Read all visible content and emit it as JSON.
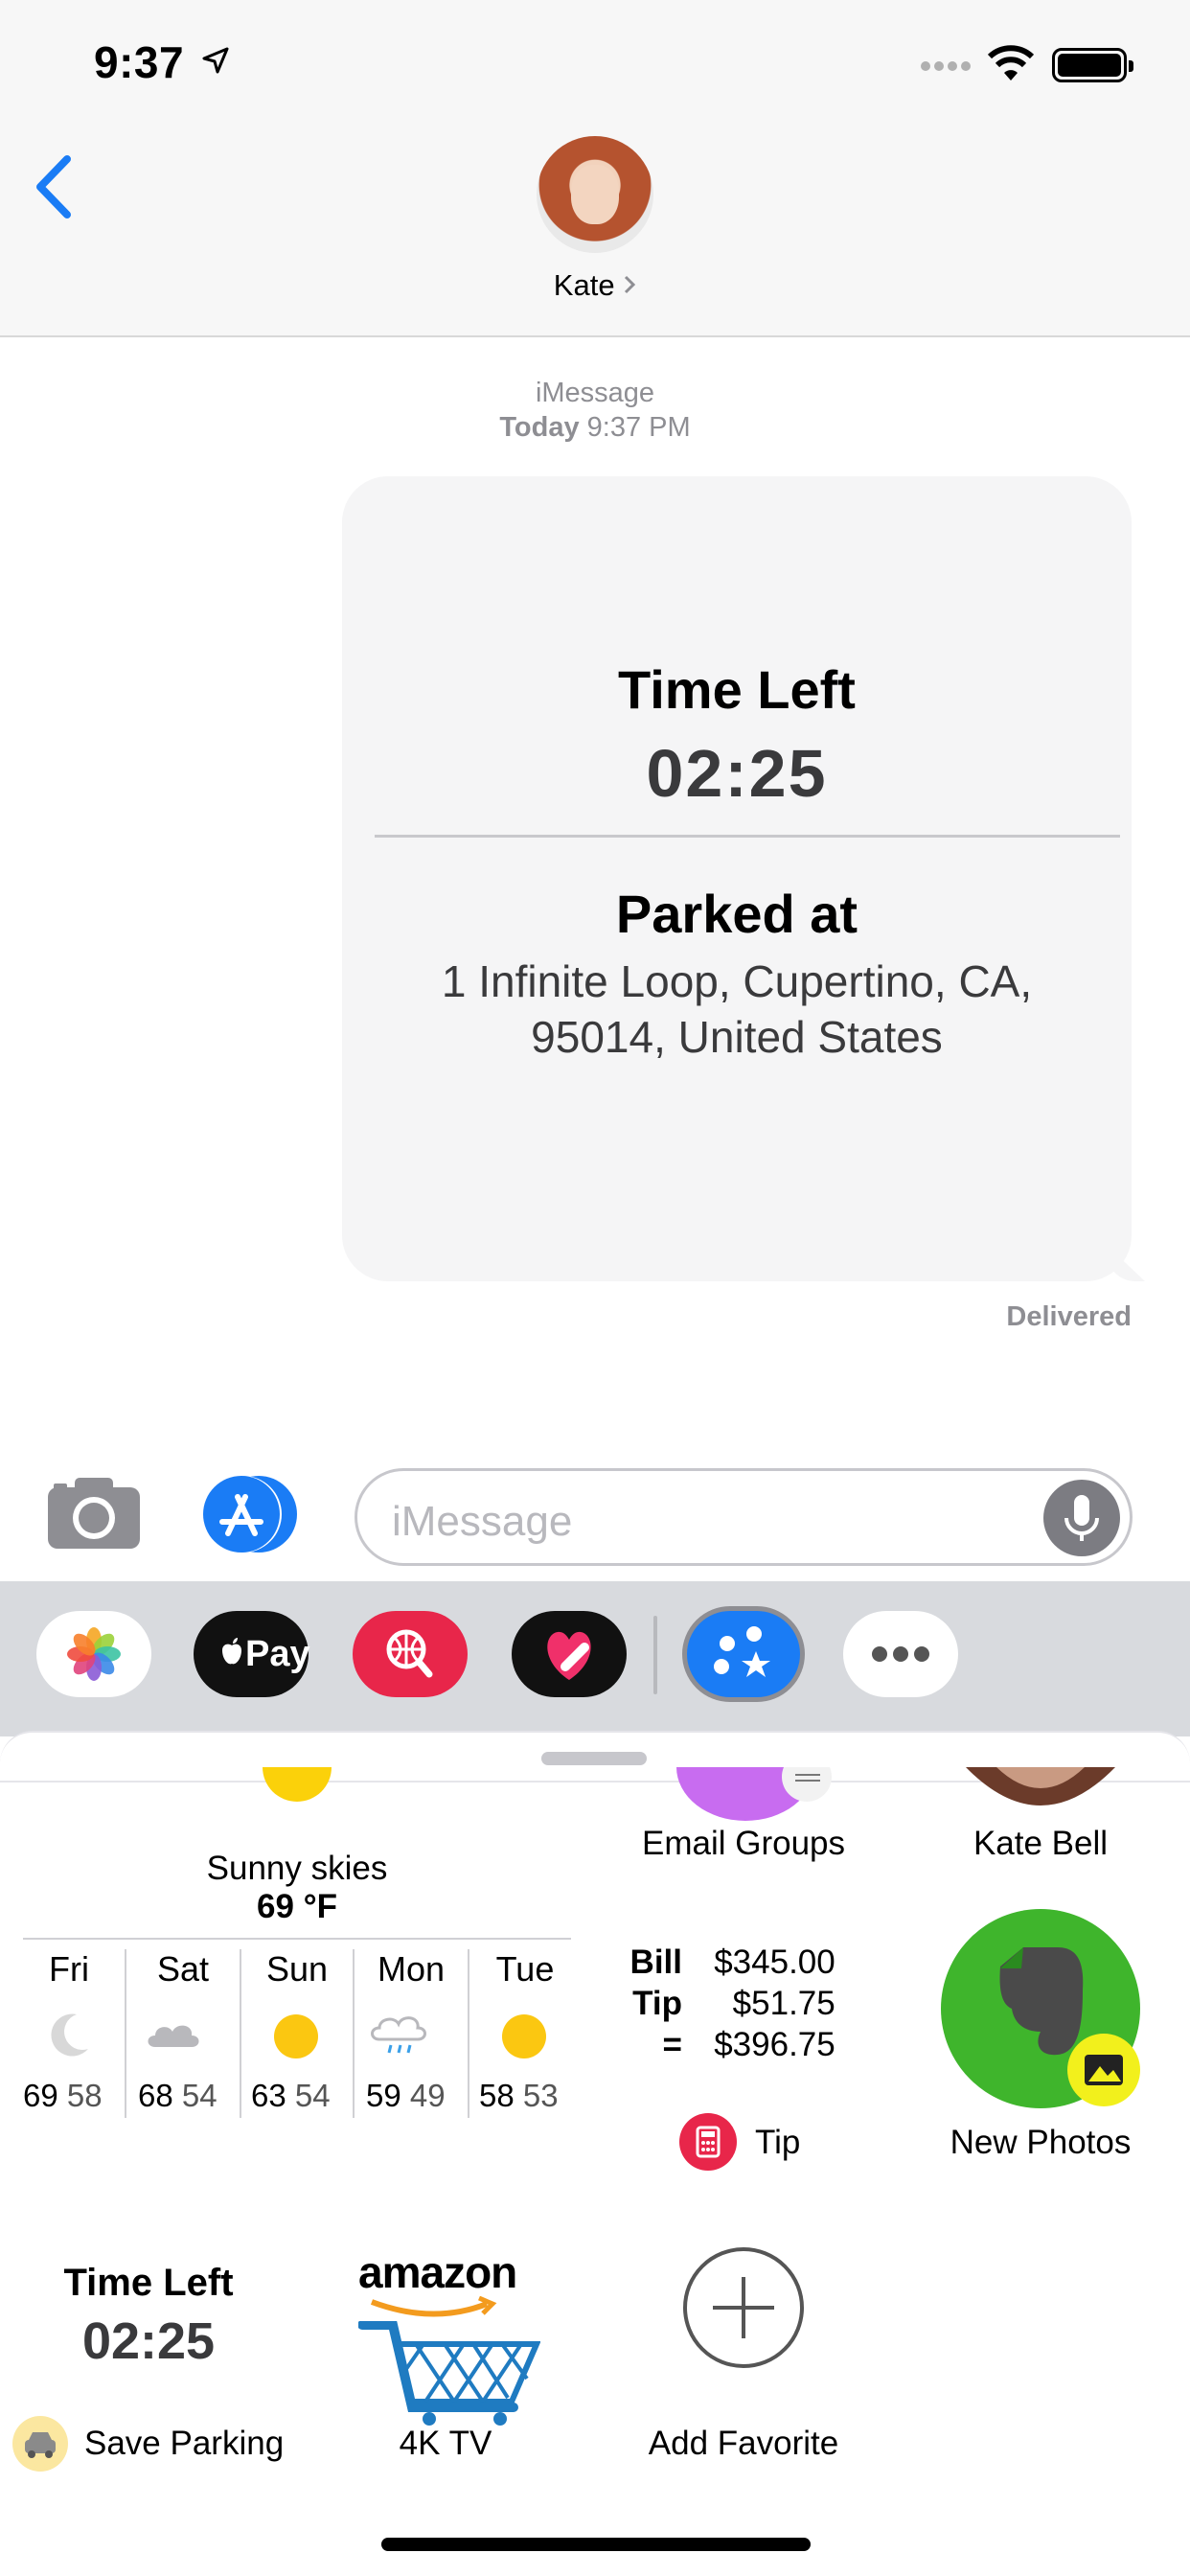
{
  "status_bar": {
    "time": "9:37"
  },
  "header": {
    "contact_name": "Kate"
  },
  "conversation": {
    "service": "iMessage",
    "day": "Today",
    "time": "9:37 PM",
    "bubble": {
      "time_left_title": "Time Left",
      "time_left_value": "02:25",
      "parked_title": "Parked at",
      "address": "1 Infinite Loop, Cupertino, CA, 95014, United States"
    },
    "status": "Delivered"
  },
  "composer": {
    "placeholder": "iMessage"
  },
  "app_strip": {
    "apple_pay_label": "Pay"
  },
  "drawer": {
    "weather": {
      "summary": "Sunny skies",
      "temp": "69 °F",
      "forecast": [
        {
          "day": "Fri",
          "icon": "moon-icon",
          "high": "69",
          "low": "58"
        },
        {
          "day": "Sat",
          "icon": "cloud-icon",
          "high": "68",
          "low": "54"
        },
        {
          "day": "Sun",
          "icon": "sun-icon",
          "high": "63",
          "low": "54"
        },
        {
          "day": "Mon",
          "icon": "rain-icon",
          "high": "59",
          "low": "49"
        },
        {
          "day": "Tue",
          "icon": "sun-icon",
          "high": "58",
          "low": "53"
        }
      ]
    },
    "email_groups_label": "Email Groups",
    "kate_bell_label": "Kate Bell",
    "tip": {
      "bill_label": "Bill",
      "bill_value": "$345.00",
      "tip_label": "Tip",
      "tip_value": "$51.75",
      "total_label": "=",
      "total_value": "$396.75",
      "app_label": "Tip"
    },
    "new_photos_label": "New Photos",
    "parking": {
      "title": "Time Left",
      "value": "02:25",
      "label": "Save Parking"
    },
    "amazon": {
      "logo": "amazon",
      "label": "4K TV"
    },
    "add_favorite_label": "Add Favorite"
  },
  "colors": {
    "accent": "#1a7cf5",
    "tip_red": "#e8264a",
    "evernote_green": "#3fb52c"
  }
}
